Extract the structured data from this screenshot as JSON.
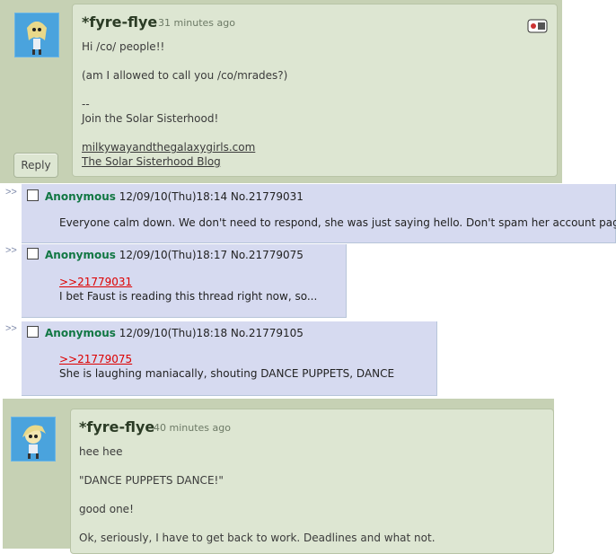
{
  "comment1": {
    "username": "*fyre-flye",
    "time_ago": "31 minutes ago",
    "lines": [
      "Hi /co/ people!!",
      "(am I allowed to call you /co/mrades?)",
      "--",
      "Join the Solar Sisterhood!"
    ],
    "links": [
      "milkywayandthegalaxygirls.com",
      "The Solar Sisterhood Blog"
    ],
    "badge_icon": "mood-emoticon-icon",
    "reply_label": "Reply"
  },
  "posts": [
    {
      "arrows": ">>",
      "name": "Anonymous",
      "datetime": "12/09/10(Thu)18:14",
      "number": "No.21779031",
      "quote": "",
      "body": "Everyone calm down. We don't need to respond, she was just saying hello. Don't spam her account page."
    },
    {
      "arrows": ">>",
      "name": "Anonymous",
      "datetime": "12/09/10(Thu)18:17",
      "number": "No.21779075",
      "quote": ">>21779031",
      "body": "I bet Faust is reading this thread right now, so..."
    },
    {
      "arrows": ">>",
      "name": "Anonymous",
      "datetime": "12/09/10(Thu)18:18",
      "number": "No.21779105",
      "quote": ">>21779075",
      "body": "She is laughing maniacally, shouting DANCE PUPPETS, DANCE"
    }
  ],
  "comment2": {
    "username": "*fyre-flye",
    "time_ago": "40 minutes ago",
    "lines": [
      "hee hee",
      "\"DANCE PUPPETS DANCE!\"",
      "good one!",
      "Ok, seriously, I have to get back to work. Deadlines and what not."
    ]
  },
  "colors": {
    "da_bg": "#c6d1b4",
    "da_card": "#dde6d2",
    "chan_reply": "#d6daf0",
    "anon_name": "#117743",
    "quote_link": "#dd0000"
  }
}
